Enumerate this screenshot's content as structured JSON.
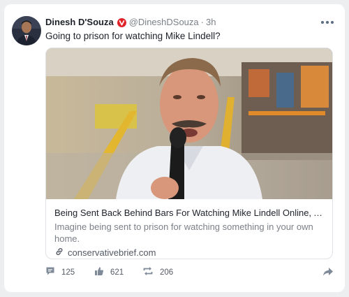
{
  "post": {
    "author_name": "Dinesh D'Souza",
    "author_handle": "@DineshDSouza",
    "separator": "·",
    "time": "3h",
    "text": "Going to prison for watching Mike Lindell?",
    "icons": {
      "avatar": "author-avatar",
      "verified": "verified-badge-icon",
      "more": "more-options-icon"
    }
  },
  "link_card": {
    "title": "Being Sent Back Behind Bars For Watching Mike Lindell Online, A Ma...",
    "description": "Imagine being sent to prison for watching something in your own home.",
    "domain": "conservativebrief.com",
    "domain_icon": "link-icon"
  },
  "actions": {
    "comments": "125",
    "likes": "621",
    "reposts": "206",
    "icons": [
      "comment-icon",
      "like-icon",
      "repost-icon",
      "share-icon"
    ]
  },
  "colors": {
    "background": "#edeef0",
    "card": "#ffffff",
    "verified": "#e0242b",
    "muted_text": "#7b8088",
    "action_icon": "#7f8a99"
  }
}
